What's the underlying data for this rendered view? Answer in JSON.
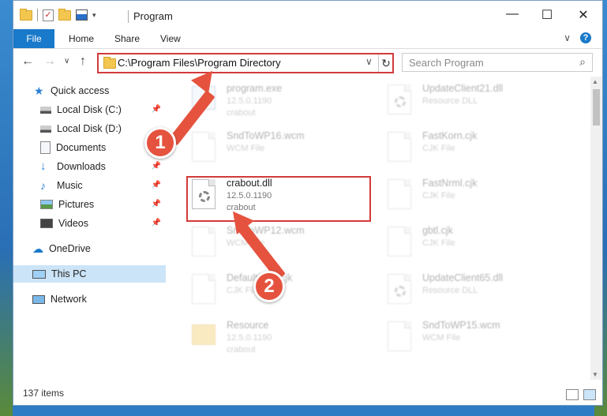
{
  "window": {
    "title": "Program",
    "minimize": "—",
    "maximize": "☐",
    "close": "✕"
  },
  "ribbon": {
    "tabs": [
      "File",
      "Home",
      "Share",
      "View"
    ],
    "help": "?",
    "collapse": "∨"
  },
  "nav": {
    "back": "←",
    "forward": "→",
    "recent": "∨",
    "up": "↑",
    "address": "C:\\Program Files\\Program Directory",
    "address_drop": "∨",
    "refresh": "↻",
    "search_placeholder": "Search Program",
    "search_icon": "⌕"
  },
  "sidebar": {
    "items": [
      {
        "label": "Quick access",
        "icon": "star-icon"
      },
      {
        "label": "Local Disk (C:)",
        "icon": "drive-icon",
        "pinned": true
      },
      {
        "label": "Local Disk (D:)",
        "icon": "drive-icon"
      },
      {
        "label": "Documents",
        "icon": "documents-icon",
        "pinned": true
      },
      {
        "label": "Downloads",
        "icon": "download-icon",
        "pinned": true
      },
      {
        "label": "Music",
        "icon": "music-icon",
        "pinned": true
      },
      {
        "label": "Pictures",
        "icon": "pictures-icon",
        "pinned": true
      },
      {
        "label": "Videos",
        "icon": "videos-icon",
        "pinned": true
      },
      {
        "label": "OneDrive",
        "icon": "cloud-icon"
      },
      {
        "label": "This PC",
        "icon": "computer-icon",
        "selected": true
      },
      {
        "label": "Network",
        "icon": "network-icon"
      }
    ],
    "pin_glyph": "📌"
  },
  "files": {
    "left": [
      {
        "name": "program.exe",
        "sub1": "12.5.0.1190",
        "sub2": "crabout",
        "kind": "exe"
      },
      {
        "name": "SndToWP16.wcm",
        "sub1": "WCM File",
        "sub2": "",
        "kind": "file"
      },
      {
        "name": "crabout.dll",
        "sub1": "12.5.0.1190",
        "sub2": "crabout",
        "kind": "dll"
      },
      {
        "name": "SndToWP12.wcm",
        "sub1": "WCM File",
        "sub2": "",
        "kind": "file"
      },
      {
        "name": "DefaultFont.cjk",
        "sub1": "CJK File",
        "sub2": "",
        "kind": "file"
      },
      {
        "name": "Resource",
        "sub1": "12.5.0.1190",
        "sub2": "crabout",
        "kind": "folder"
      }
    ],
    "right": [
      {
        "name": "UpdateClient21.dll",
        "sub1": "Resource DLL",
        "sub2": "",
        "kind": "dll"
      },
      {
        "name": "FastKorn.cjk",
        "sub1": "CJK File",
        "sub2": "",
        "kind": "file"
      },
      {
        "name": "FastNrml.cjk",
        "sub1": "CJK File",
        "sub2": "",
        "kind": "file"
      },
      {
        "name": "gbtl.cjk",
        "sub1": "CJK File",
        "sub2": "",
        "kind": "file"
      },
      {
        "name": "UpdateClient65.dll",
        "sub1": "Resource DLL",
        "sub2": "",
        "kind": "dll"
      },
      {
        "name": "SndToWP15.wcm",
        "sub1": "WCM File",
        "sub2": "",
        "kind": "file"
      }
    ]
  },
  "annotations": {
    "step1": "1",
    "step2": "2",
    "color": "#e5533f"
  },
  "status": {
    "count": "137 items"
  },
  "colors": {
    "accent": "#1979ca",
    "highlight": "#d33a3a",
    "selected_bg": "#cce4f7"
  }
}
